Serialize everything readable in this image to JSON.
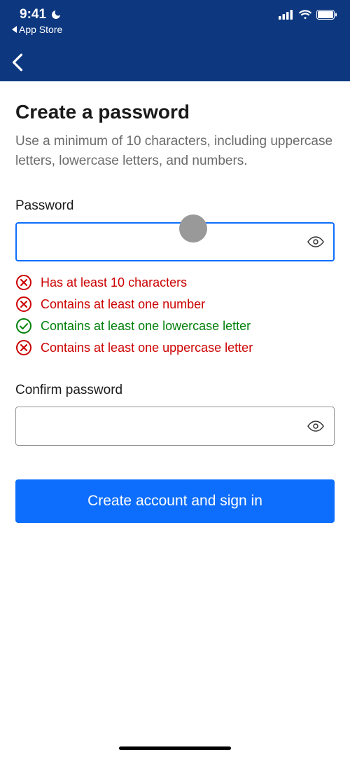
{
  "status_bar": {
    "time": "9:41",
    "back_app": "App Store"
  },
  "page": {
    "title": "Create a password",
    "subtitle": "Use a minimum of 10 characters, including uppercase letters, lowercase letters, and numbers."
  },
  "password_field": {
    "label": "Password",
    "value": ""
  },
  "requirements": [
    {
      "text": "Has at least 10 characters",
      "status": "fail"
    },
    {
      "text": "Contains at least one number",
      "status": "fail"
    },
    {
      "text": "Contains at least one lowercase letter",
      "status": "pass"
    },
    {
      "text": "Contains at least one uppercase letter",
      "status": "fail"
    }
  ],
  "confirm_field": {
    "label": "Confirm password",
    "value": ""
  },
  "submit": {
    "label": "Create account and sign in"
  }
}
